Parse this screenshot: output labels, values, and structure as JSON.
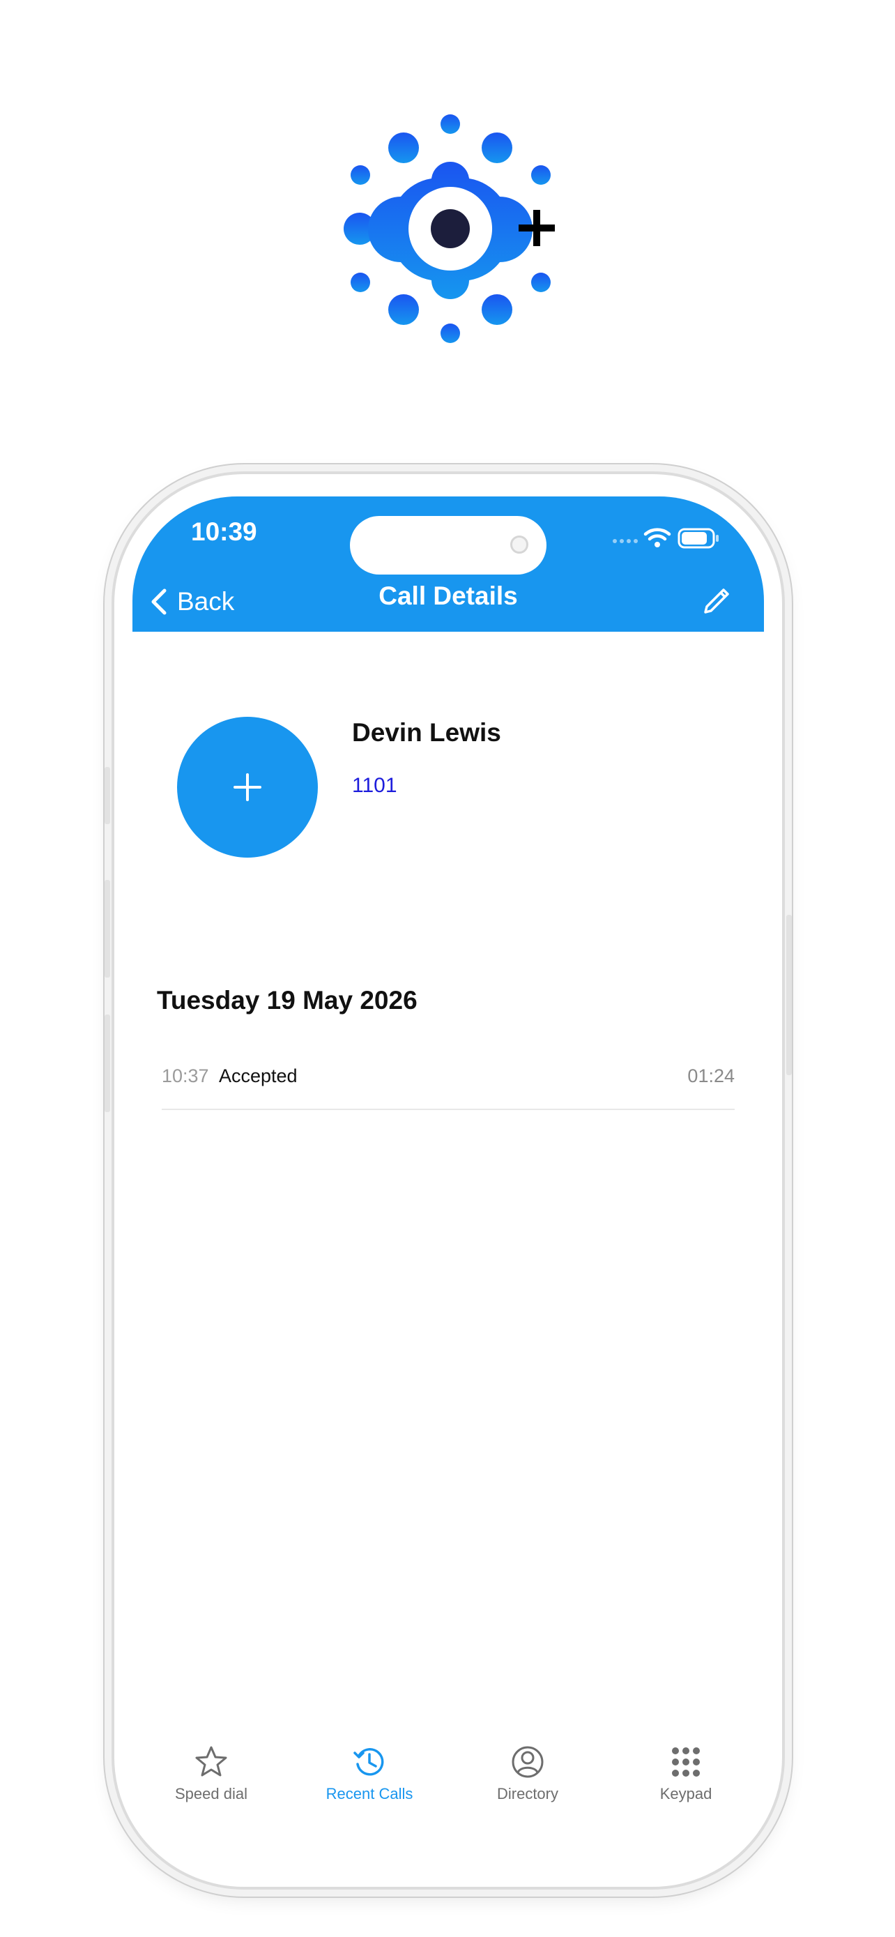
{
  "status_bar": {
    "time": "10:39"
  },
  "nav": {
    "back_label": "Back",
    "title": "Call Details"
  },
  "contact": {
    "name": "Devin Lewis",
    "number": "1101"
  },
  "call_history": {
    "date": "Tuesday 19 May 2026",
    "entries": [
      {
        "time": "10:37",
        "status": "Accepted",
        "duration": "01:24"
      }
    ]
  },
  "tabs": [
    {
      "label": "Speed dial",
      "icon": "star-icon",
      "active": false
    },
    {
      "label": "Recent Calls",
      "icon": "history-icon",
      "active": true
    },
    {
      "label": "Directory",
      "icon": "person-circle-icon",
      "active": false
    },
    {
      "label": "Keypad",
      "icon": "keypad-icon",
      "active": false
    }
  ],
  "colors": {
    "accent": "#1896ef",
    "number_link": "#1d1ddc",
    "logo_blue": "#1c6ef0",
    "logo_center": "#1c1e3c"
  }
}
